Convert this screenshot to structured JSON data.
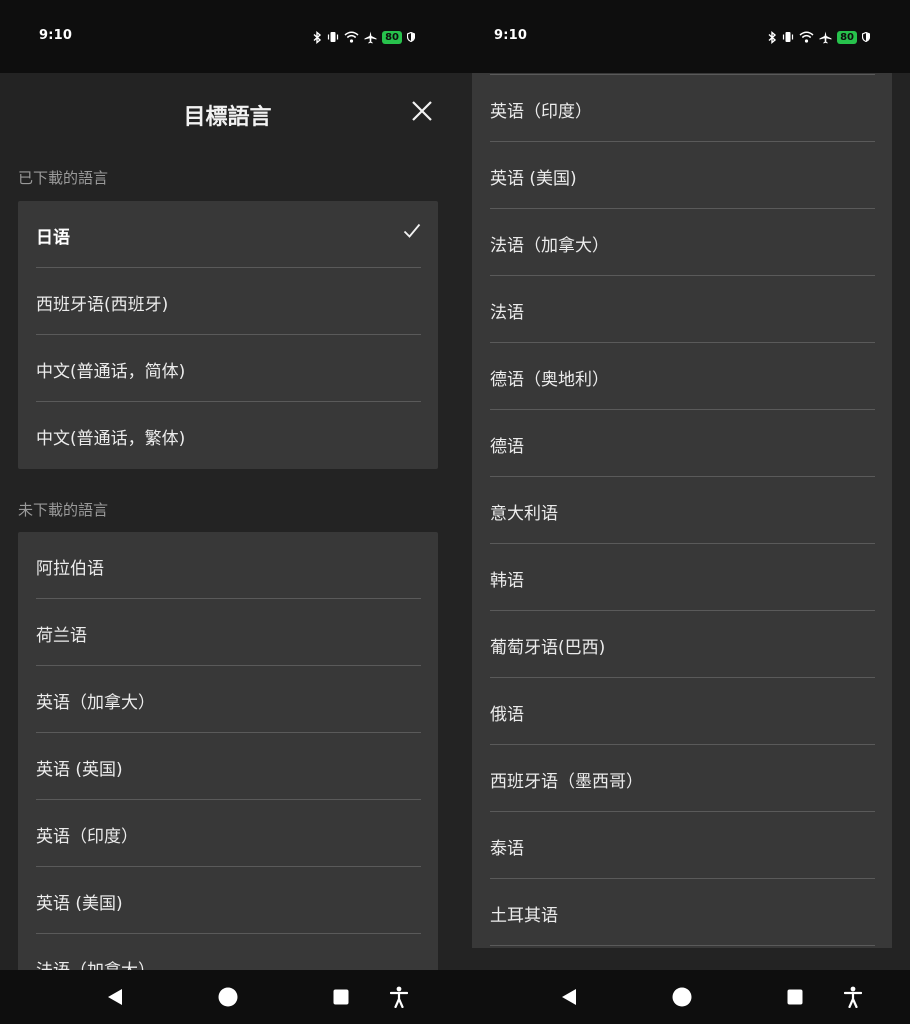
{
  "status": {
    "time": "9:10",
    "battery": "80"
  },
  "header": {
    "title": "目標語言"
  },
  "downloaded": {
    "section_label": "已下載的語言",
    "items": [
      {
        "label": "日语",
        "selected": true
      },
      {
        "label": "西班牙语(西班牙)"
      },
      {
        "label": "中文(普通话，简体)"
      },
      {
        "label": "中文(普通话，繁体)"
      }
    ]
  },
  "not_downloaded": {
    "section_label": "未下載的語言",
    "items": [
      {
        "label": "阿拉伯语"
      },
      {
        "label": "荷兰语"
      },
      {
        "label": "英语（加拿大）"
      },
      {
        "label": "英语 (英国)"
      },
      {
        "label": "英语（印度）"
      },
      {
        "label": "英语 (美国)"
      },
      {
        "label": "法语（加拿大）"
      },
      {
        "label": "法语"
      },
      {
        "label": "德语（奥地利）"
      },
      {
        "label": "德语"
      },
      {
        "label": "意大利语"
      },
      {
        "label": "韩语"
      },
      {
        "label": "葡萄牙语(巴西)"
      },
      {
        "label": "俄语"
      },
      {
        "label": "西班牙语（墨西哥）"
      },
      {
        "label": "泰语"
      },
      {
        "label": "土耳其语"
      }
    ]
  },
  "icons": {
    "close": "close-icon",
    "check": "check-icon",
    "nav": [
      "back-icon",
      "home-icon",
      "recents-icon",
      "accessibility-icon"
    ]
  },
  "colors": {
    "background": "#232323",
    "card": "#383838",
    "battery": "#27c24c"
  }
}
